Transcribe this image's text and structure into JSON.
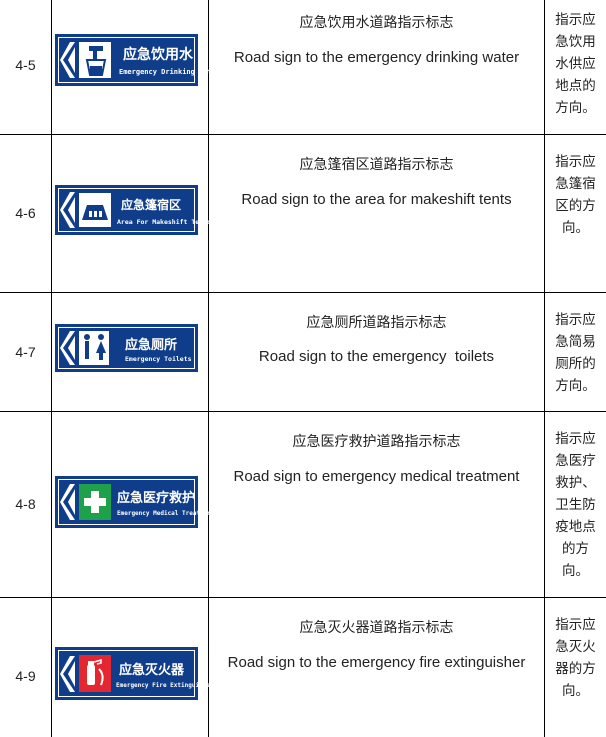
{
  "colors": {
    "sign_blue": "#0f3d8a",
    "first_aid_green": "#1ea14a",
    "fire_red": "#e3262f",
    "grid": "#000000"
  },
  "rows": [
    {
      "id": "4-5",
      "icon": "water-tap-icon",
      "sign_cn": "应急饮用水",
      "sign_en": "Emergency Drinking Water",
      "title_cn": "应急饮用水道路指示标志",
      "title_en": "Road sign to the emergency drinking water",
      "desc_lines": [
        "指示应",
        "急饮用",
        "水供应",
        "地点的",
        "方向。"
      ]
    },
    {
      "id": "4-6",
      "icon": "tent-icon",
      "sign_cn": "应急篷宿区",
      "sign_en": "Area For Makeshift Tents",
      "title_cn": "应急篷宿区道路指示标志",
      "title_en": "Road sign to the area for makeshift tents",
      "desc_lines": [
        "指示应",
        "急篷宿",
        "区的方",
        "向。"
      ]
    },
    {
      "id": "4-7",
      "icon": "toilet-icon",
      "sign_cn": "应急厕所",
      "sign_en": "Emergency Toilets",
      "title_cn": "应急厕所道路指示标志",
      "title_en": "Road sign to the emergency  toilets",
      "desc_lines": [
        "指示应",
        "急简易",
        "厕所的",
        "方向。"
      ]
    },
    {
      "id": "4-8",
      "icon": "medical-cross-icon",
      "sign_cn": "应急医疗救护",
      "sign_en": "Emergency Medical Treatment",
      "title_cn": "应急医疗救护道路指示标志",
      "title_en": "Road sign to emergency medical treatment",
      "desc_lines": [
        "指示应",
        "急医疗",
        "救护、",
        "卫生防",
        "疫地点",
        "的方",
        "向。"
      ]
    },
    {
      "id": "4-9",
      "icon": "fire-extinguisher-icon",
      "sign_cn": "应急灭火器",
      "sign_en": "Emergency Fire Extinguisher",
      "title_cn": "应急灭火器道路指示标志",
      "title_en": "Road sign to the emergency fire extinguisher",
      "desc_lines": [
        "指示应",
        "急灭火",
        "器的方",
        "向。"
      ]
    }
  ]
}
